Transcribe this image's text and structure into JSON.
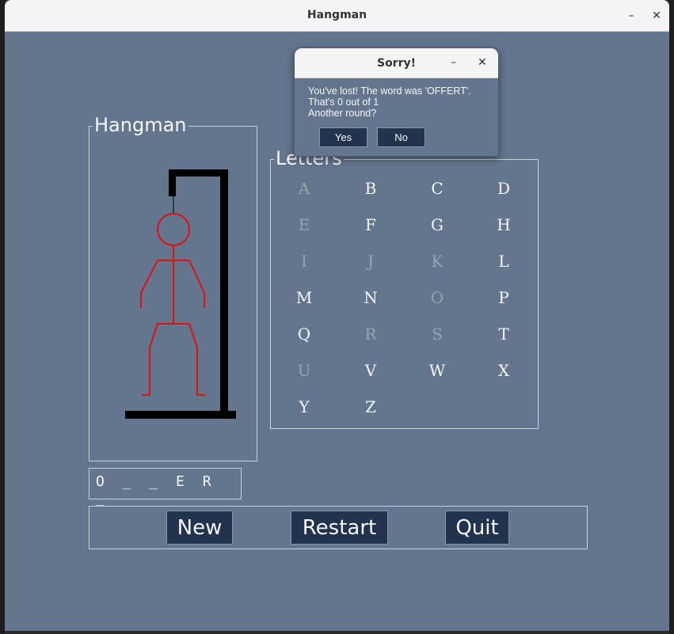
{
  "window": {
    "title": "Hangman",
    "minimize_glyph": "–",
    "close_glyph": "✕"
  },
  "hangman_panel": {
    "label": "Hangman"
  },
  "letters_panel": {
    "label": "Letters",
    "letters": [
      {
        "char": "A",
        "used": true
      },
      {
        "char": "B",
        "used": false
      },
      {
        "char": "C",
        "used": false
      },
      {
        "char": "D",
        "used": false
      },
      {
        "char": "E",
        "used": true
      },
      {
        "char": "F",
        "used": false
      },
      {
        "char": "G",
        "used": false
      },
      {
        "char": "H",
        "used": false
      },
      {
        "char": "I",
        "used": true
      },
      {
        "char": "J",
        "used": true
      },
      {
        "char": "K",
        "used": true
      },
      {
        "char": "L",
        "used": false
      },
      {
        "char": "M",
        "used": false
      },
      {
        "char": "N",
        "used": false
      },
      {
        "char": "O",
        "used": true
      },
      {
        "char": "P",
        "used": false
      },
      {
        "char": "Q",
        "used": false
      },
      {
        "char": "R",
        "used": true
      },
      {
        "char": "S",
        "used": true
      },
      {
        "char": "T",
        "used": false
      },
      {
        "char": "U",
        "used": true
      },
      {
        "char": "V",
        "used": false
      },
      {
        "char": "W",
        "used": false
      },
      {
        "char": "X",
        "used": false
      },
      {
        "char": "Y",
        "used": false
      },
      {
        "char": "Z",
        "used": false
      }
    ]
  },
  "word_display": {
    "text": "O _ _ E R _"
  },
  "buttons": {
    "new": "New",
    "restart": "Restart",
    "quit": "Quit"
  },
  "dialog": {
    "title": "Sorry!",
    "minimize_glyph": "–",
    "close_glyph": "✕",
    "line1": "You've lost! The word was 'OFFERT'.",
    "line2": "That's 0 out of 1",
    "line3": "Another round?",
    "yes": "Yes",
    "no": "No"
  },
  "colors": {
    "background": "#64768e",
    "button": "#22334f",
    "figure": "#e01010",
    "gallows": "#000000",
    "used_letter": "#9aa3ad"
  }
}
